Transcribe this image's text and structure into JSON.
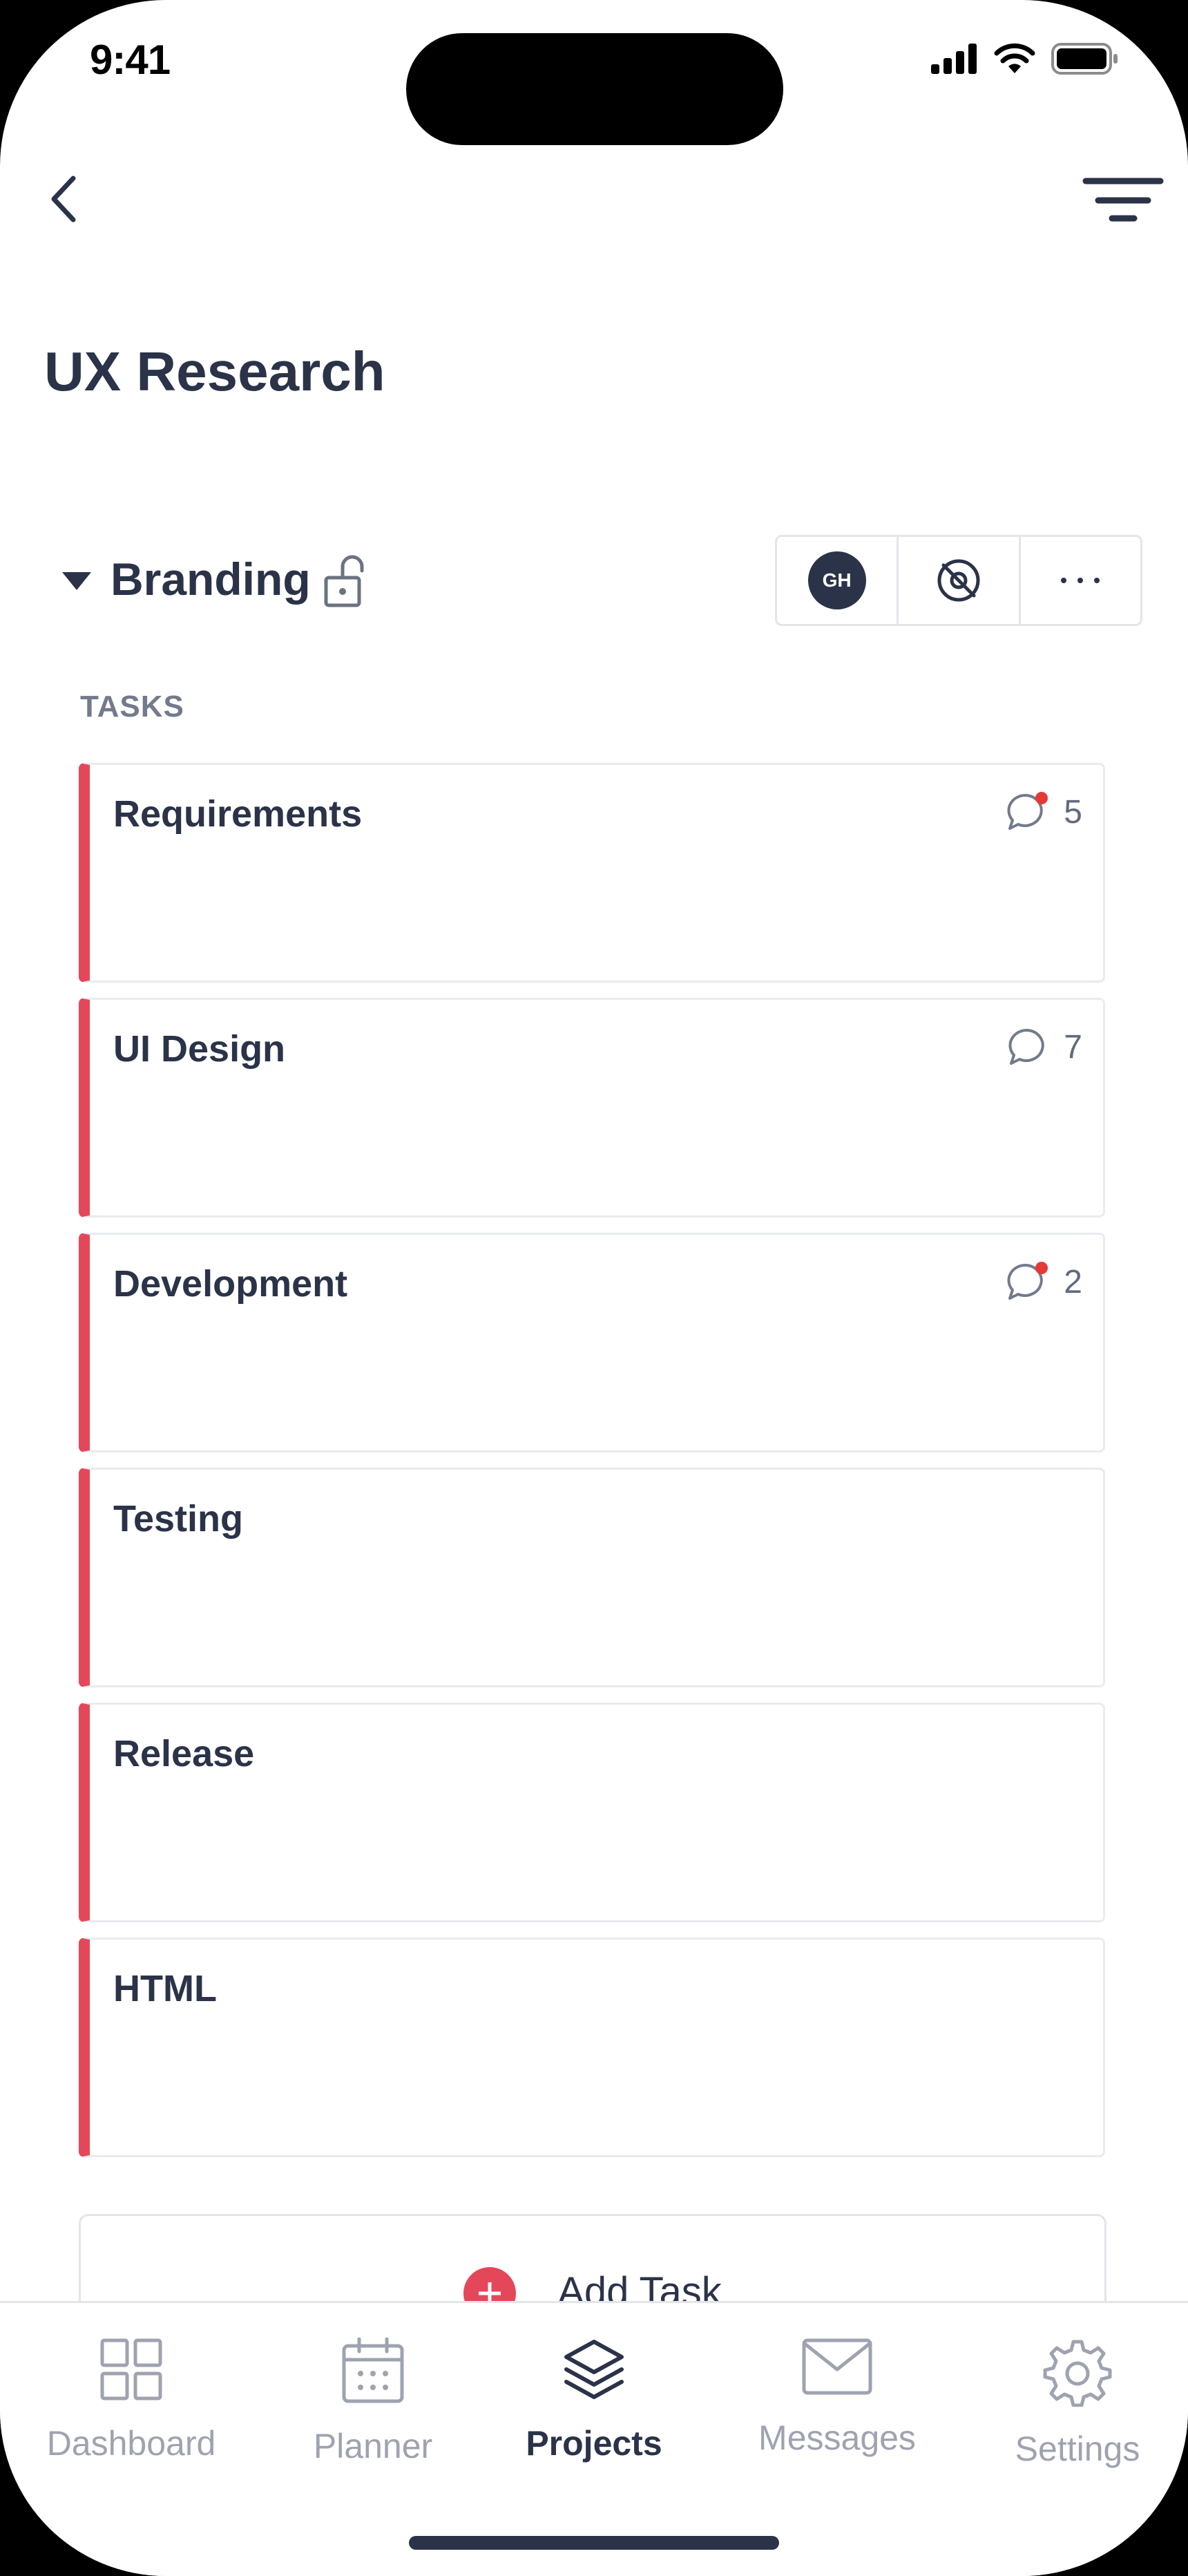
{
  "status_bar": {
    "time": "9:41"
  },
  "header": {
    "title": "UX Research"
  },
  "section": {
    "title": "Branding",
    "avatar_initials": "GH",
    "tasks_label": "TASKS"
  },
  "tasks": [
    {
      "name": "Requirements",
      "comments": "5",
      "unread": true
    },
    {
      "name": "UI Design",
      "comments": "7",
      "unread": false
    },
    {
      "name": "Development",
      "comments": "2",
      "unread": true
    },
    {
      "name": "Testing"
    },
    {
      "name": "Release"
    },
    {
      "name": "HTML"
    }
  ],
  "add_task": {
    "label": "Add Task"
  },
  "tab_bar": {
    "items": [
      {
        "label": "Dashboard",
        "icon": "grid-icon"
      },
      {
        "label": "Planner",
        "icon": "calendar-icon"
      },
      {
        "label": "Projects",
        "icon": "layers-icon",
        "active": true
      },
      {
        "label": "Messages",
        "icon": "mail-icon"
      },
      {
        "label": "Settings",
        "icon": "gear-icon"
      }
    ]
  },
  "colors": {
    "accent": "#e5475a",
    "text_dark": "#2b3349",
    "text_muted": "#737a8c",
    "tab_inactive": "#9ea3af",
    "border": "#e3e5ea"
  }
}
